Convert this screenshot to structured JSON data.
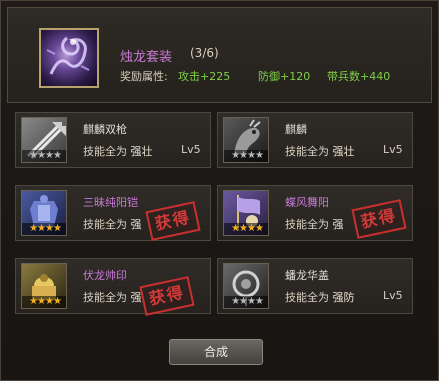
{
  "set": {
    "icon": "dragon-icon",
    "name": "烛龙套装",
    "count": "(3/6)",
    "bonus_label": "奖励属性:",
    "bonuses": [
      "攻击+225",
      "防御+120",
      "带兵数+440"
    ]
  },
  "cards": [
    {
      "name": "麒麟双枪",
      "name_color": "#e0dcd4",
      "skill_label": "技能全为",
      "skill_value": "强壮",
      "level": "Lv5",
      "stars": 4,
      "stars_on": 0,
      "stamp": "",
      "icon": "twin-spears-icon"
    },
    {
      "name": "麒麟",
      "name_color": "#e0dcd4",
      "skill_label": "技能全为",
      "skill_value": "强壮",
      "level": "Lv5",
      "stars": 4,
      "stars_on": 0,
      "stamp": "",
      "icon": "qilin-mount-icon"
    },
    {
      "name": "三昧纯阳铠",
      "name_color": "#c97ad8",
      "skill_label": "技能全为",
      "skill_value": "强",
      "level": "",
      "stars": 4,
      "stars_on": 4,
      "stamp": "获得",
      "icon": "armor-icon"
    },
    {
      "name": "蝶风舞阳",
      "name_color": "#c97ad8",
      "skill_label": "技能全为",
      "skill_value": "强",
      "level": "",
      "stars": 4,
      "stars_on": 4,
      "stamp": "获得",
      "icon": "banner-icon"
    },
    {
      "name": "伏龙帅印",
      "name_color": "#c97ad8",
      "skill_label": "技能全为",
      "skill_value": "强",
      "level": "",
      "stars": 4,
      "stars_on": 4,
      "stamp": "获得",
      "icon": "seal-icon"
    },
    {
      "name": "蟠龙华盖",
      "name_color": "#e0dcd4",
      "skill_label": "技能全为",
      "skill_value": "强防",
      "level": "Lv5",
      "stars": 4,
      "stars_on": 0,
      "stamp": "",
      "icon": "canopy-icon"
    }
  ],
  "buttons": {
    "synthesize": "合成"
  }
}
